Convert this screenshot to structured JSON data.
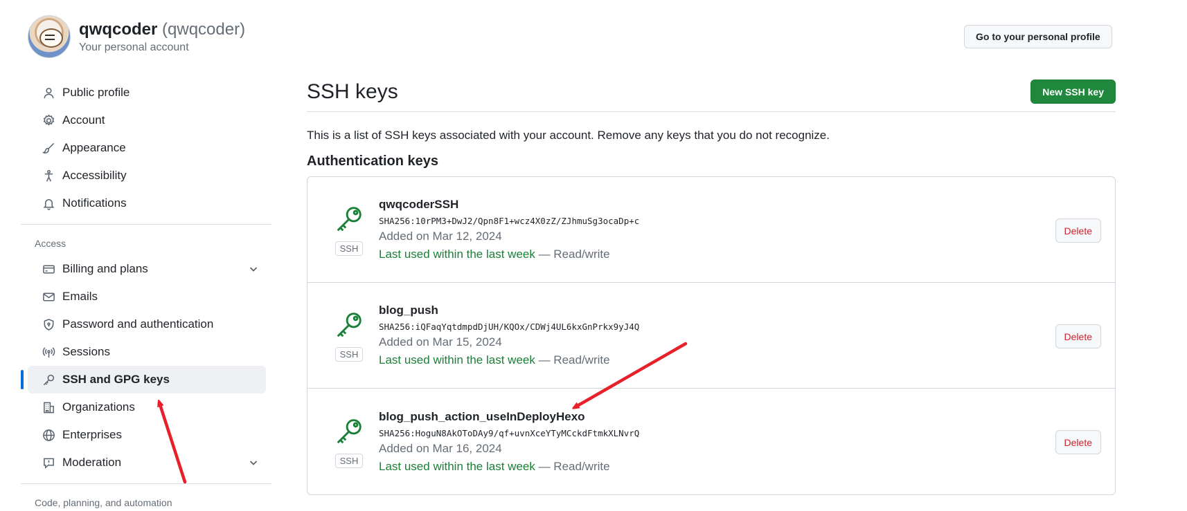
{
  "header": {
    "username": "qwqcoder",
    "login": "(qwqcoder)",
    "subtitle": "Your personal account",
    "profile_button": "Go to your personal profile"
  },
  "sidebar": {
    "items_top": [
      {
        "label": "Public profile",
        "icon": "person-icon"
      },
      {
        "label": "Account",
        "icon": "gear-icon"
      },
      {
        "label": "Appearance",
        "icon": "paintbrush-icon"
      },
      {
        "label": "Accessibility",
        "icon": "accessibility-icon"
      },
      {
        "label": "Notifications",
        "icon": "bell-icon"
      }
    ],
    "access_label": "Access",
    "items_access": [
      {
        "label": "Billing and plans",
        "icon": "credit-card-icon",
        "expandable": true
      },
      {
        "label": "Emails",
        "icon": "mail-icon"
      },
      {
        "label": "Password and authentication",
        "icon": "shield-icon"
      },
      {
        "label": "Sessions",
        "icon": "broadcast-icon"
      },
      {
        "label": "SSH and GPG keys",
        "icon": "key-icon",
        "active": true
      },
      {
        "label": "Organizations",
        "icon": "organization-icon"
      },
      {
        "label": "Enterprises",
        "icon": "globe-icon"
      },
      {
        "label": "Moderation",
        "icon": "report-icon",
        "expandable": true
      }
    ],
    "next_group_label": "Code, planning, and automation"
  },
  "main": {
    "title": "SSH keys",
    "new_key_button": "New SSH key",
    "intro": "This is a list of SSH keys associated with your account. Remove any keys that you do not recognize.",
    "section_title": "Authentication keys",
    "keys": [
      {
        "name": "qwqcoderSSH",
        "fingerprint": "SHA256:10rPM3+DwJ2/Qpn8F1+wcz4X0zZ/ZJhmuSg3ocaDp+c",
        "added": "Added on Mar 12, 2024",
        "last_used": "Last used within the last week",
        "access": " — Read/write",
        "badge": "SSH",
        "delete_label": "Delete"
      },
      {
        "name": "blog_push",
        "fingerprint": "SHA256:iQFaqYqtdmpdDjUH/KQOx/CDWj4UL6kxGnPrkx9yJ4Q",
        "added": "Added on Mar 15, 2024",
        "last_used": "Last used within the last week",
        "access": " — Read/write",
        "badge": "SSH",
        "delete_label": "Delete"
      },
      {
        "name": "blog_push_action_useInDeployHexo",
        "fingerprint": "SHA256:HoguN8AkOToDAy9/qf+uvnXceYTyMCckdFtmkXLNvrQ",
        "added": "Added on Mar 16, 2024",
        "last_used": "Last used within the last week",
        "access": " — Read/write",
        "badge": "SSH",
        "delete_label": "Delete"
      }
    ]
  },
  "colors": {
    "accent_blue": "#0969da",
    "success_green": "#1f883d",
    "danger_red": "#cf222e",
    "annotation_red": "#e8202a"
  }
}
